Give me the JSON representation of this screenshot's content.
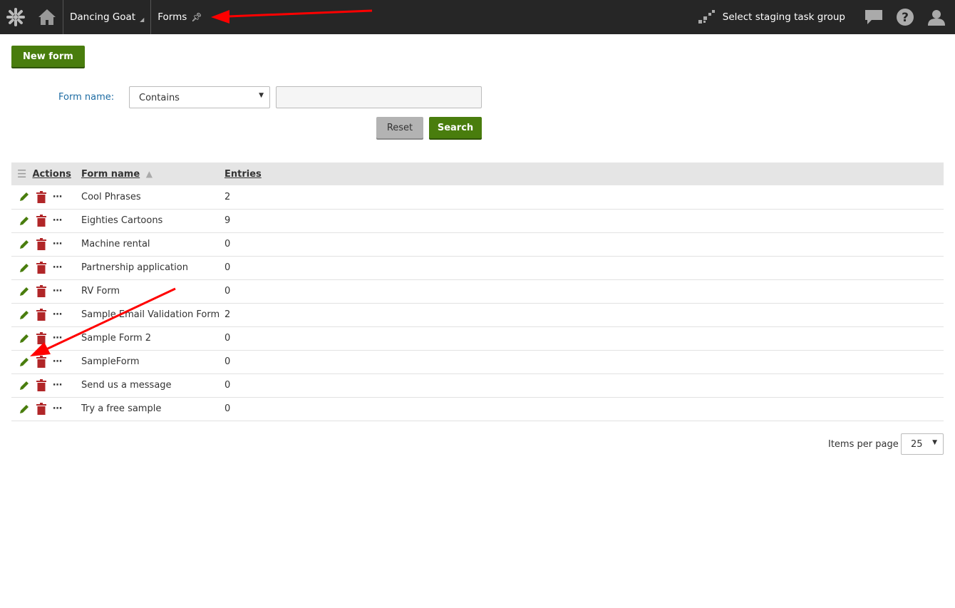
{
  "header": {
    "site": "Dancing Goat",
    "app": "Forms",
    "staging": "Select staging task group"
  },
  "toolbar": {
    "new_form": "New form"
  },
  "filter": {
    "label": "Form name:",
    "operator": "Contains",
    "value": "",
    "reset": "Reset",
    "search": "Search"
  },
  "table": {
    "columns": [
      "Actions",
      "Form name",
      "Entries"
    ],
    "sort": "Form name ascending",
    "rows": [
      {
        "name": "Cool Phrases",
        "entries": "2"
      },
      {
        "name": "Eighties Cartoons",
        "entries": "9"
      },
      {
        "name": "Machine rental",
        "entries": "0"
      },
      {
        "name": "Partnership application",
        "entries": "0"
      },
      {
        "name": "RV Form",
        "entries": "0"
      },
      {
        "name": "Sample Email Validation Form",
        "entries": "2"
      },
      {
        "name": "Sample Form 2",
        "entries": "0"
      },
      {
        "name": "SampleForm",
        "entries": "0"
      },
      {
        "name": "Send us a message",
        "entries": "0"
      },
      {
        "name": "Try a free sample",
        "entries": "0"
      }
    ]
  },
  "pager": {
    "label": "Items per page",
    "value": "25"
  },
  "colors": {
    "accent": "#497d0d",
    "delete": "#b12628",
    "topbar": "#262626",
    "link": "#1e6ca3",
    "annotation": "#ff0000"
  }
}
